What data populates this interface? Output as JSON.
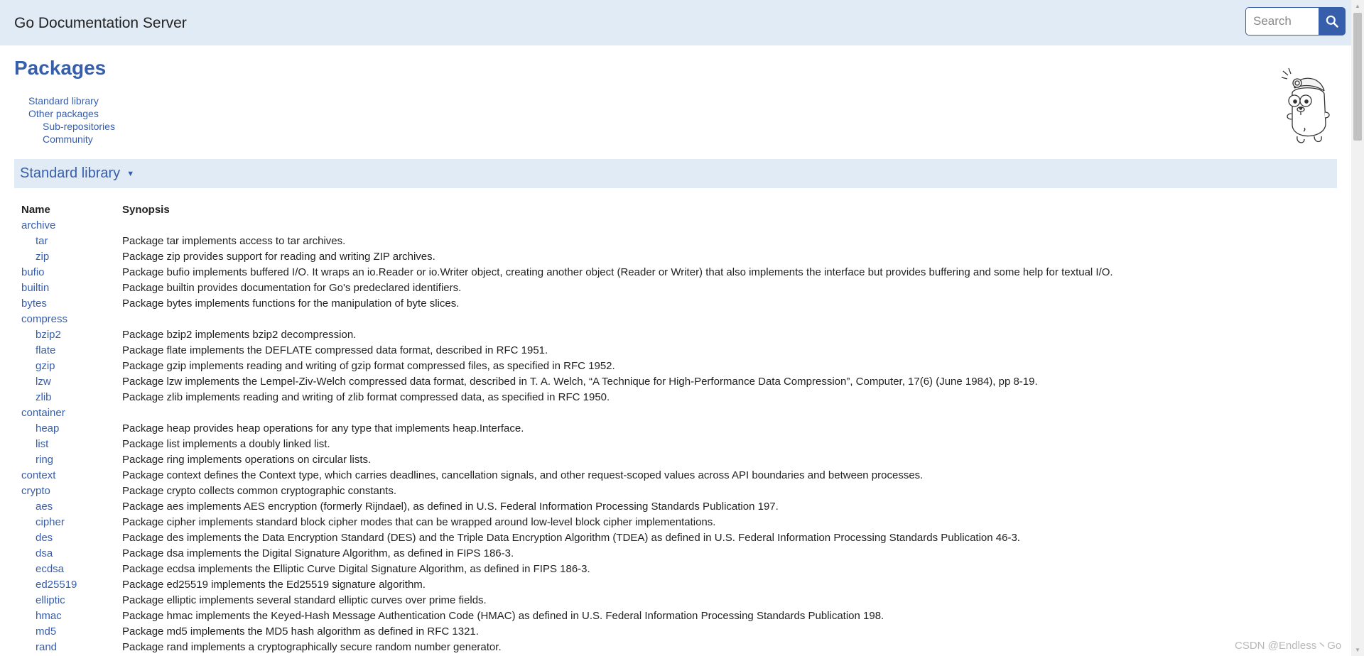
{
  "header": {
    "title": "Go Documentation Server",
    "search_placeholder": "Search",
    "search_icon": "search-icon"
  },
  "page": {
    "title": "Packages",
    "toc": [
      {
        "label": "Standard library",
        "indent": 0
      },
      {
        "label": "Other packages",
        "indent": 0
      },
      {
        "label": "Sub-repositories",
        "indent": 1
      },
      {
        "label": "Community",
        "indent": 1
      }
    ],
    "mascot_icon": "gopher-icon"
  },
  "section": {
    "title": "Standard library",
    "caret": "▼"
  },
  "table": {
    "headers": [
      "Name",
      "Synopsis"
    ],
    "rows": [
      {
        "name": "archive",
        "child": false,
        "synopsis": ""
      },
      {
        "name": "tar",
        "child": true,
        "synopsis": "Package tar implements access to tar archives."
      },
      {
        "name": "zip",
        "child": true,
        "synopsis": "Package zip provides support for reading and writing ZIP archives."
      },
      {
        "name": "bufio",
        "child": false,
        "synopsis": "Package bufio implements buffered I/O. It wraps an io.Reader or io.Writer object, creating another object (Reader or Writer) that also implements the interface but provides buffering and some help for textual I/O."
      },
      {
        "name": "builtin",
        "child": false,
        "synopsis": "Package builtin provides documentation for Go's predeclared identifiers."
      },
      {
        "name": "bytes",
        "child": false,
        "synopsis": "Package bytes implements functions for the manipulation of byte slices."
      },
      {
        "name": "compress",
        "child": false,
        "synopsis": ""
      },
      {
        "name": "bzip2",
        "child": true,
        "synopsis": "Package bzip2 implements bzip2 decompression."
      },
      {
        "name": "flate",
        "child": true,
        "synopsis": "Package flate implements the DEFLATE compressed data format, described in RFC 1951."
      },
      {
        "name": "gzip",
        "child": true,
        "synopsis": "Package gzip implements reading and writing of gzip format compressed files, as specified in RFC 1952."
      },
      {
        "name": "lzw",
        "child": true,
        "synopsis": "Package lzw implements the Lempel-Ziv-Welch compressed data format, described in T. A. Welch, “A Technique for High-Performance Data Compression”, Computer, 17(6) (June 1984), pp 8-19."
      },
      {
        "name": "zlib",
        "child": true,
        "synopsis": "Package zlib implements reading and writing of zlib format compressed data, as specified in RFC 1950."
      },
      {
        "name": "container",
        "child": false,
        "synopsis": ""
      },
      {
        "name": "heap",
        "child": true,
        "synopsis": "Package heap provides heap operations for any type that implements heap.Interface."
      },
      {
        "name": "list",
        "child": true,
        "synopsis": "Package list implements a doubly linked list."
      },
      {
        "name": "ring",
        "child": true,
        "synopsis": "Package ring implements operations on circular lists."
      },
      {
        "name": "context",
        "child": false,
        "synopsis": "Package context defines the Context type, which carries deadlines, cancellation signals, and other request-scoped values across API boundaries and between processes."
      },
      {
        "name": "crypto",
        "child": false,
        "synopsis": "Package crypto collects common cryptographic constants."
      },
      {
        "name": "aes",
        "child": true,
        "synopsis": "Package aes implements AES encryption (formerly Rijndael), as defined in U.S. Federal Information Processing Standards Publication 197."
      },
      {
        "name": "cipher",
        "child": true,
        "synopsis": "Package cipher implements standard block cipher modes that can be wrapped around low-level block cipher implementations."
      },
      {
        "name": "des",
        "child": true,
        "synopsis": "Package des implements the Data Encryption Standard (DES) and the Triple Data Encryption Algorithm (TDEA) as defined in U.S. Federal Information Processing Standards Publication 46-3."
      },
      {
        "name": "dsa",
        "child": true,
        "synopsis": "Package dsa implements the Digital Signature Algorithm, as defined in FIPS 186-3."
      },
      {
        "name": "ecdsa",
        "child": true,
        "synopsis": "Package ecdsa implements the Elliptic Curve Digital Signature Algorithm, as defined in FIPS 186-3."
      },
      {
        "name": "ed25519",
        "child": true,
        "synopsis": "Package ed25519 implements the Ed25519 signature algorithm."
      },
      {
        "name": "elliptic",
        "child": true,
        "synopsis": "Package elliptic implements several standard elliptic curves over prime fields."
      },
      {
        "name": "hmac",
        "child": true,
        "synopsis": "Package hmac implements the Keyed-Hash Message Authentication Code (HMAC) as defined in U.S. Federal Information Processing Standards Publication 198."
      },
      {
        "name": "md5",
        "child": true,
        "synopsis": "Package md5 implements the MD5 hash algorithm as defined in RFC 1321."
      },
      {
        "name": "rand",
        "child": true,
        "synopsis": "Package rand implements a cryptographically secure random number generator."
      }
    ]
  },
  "watermark": "CSDN @Endless丶Go",
  "colors": {
    "accent": "#375eab",
    "header_bg": "#e0ebf5"
  }
}
